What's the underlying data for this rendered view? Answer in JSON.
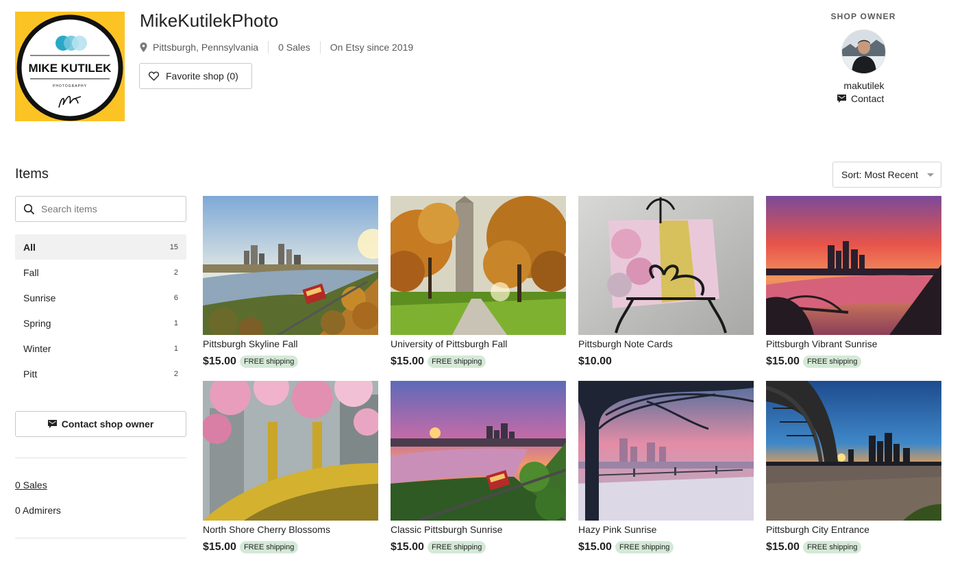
{
  "shop": {
    "name": "MikeKutilekPhoto",
    "logo_text": "MIKE KUTILEK",
    "logo_subtext": "PHOTOGRAPHY",
    "location": "Pittsburgh, Pennsylvania",
    "sales": "0 Sales",
    "since": "On Etsy since 2019",
    "favorite_label": "Favorite shop (0)",
    "icons": {
      "location": "location-pin-icon",
      "favorite": "heart-icon"
    }
  },
  "owner": {
    "label": "SHOP OWNER",
    "username": "makutilek",
    "contact_label": "Contact",
    "icons": {
      "contact": "message-icon"
    }
  },
  "items": {
    "title": "Items",
    "sort_label": "Sort: Most Recent",
    "search_placeholder": "Search items"
  },
  "sidebar": {
    "categories": [
      {
        "label": "All",
        "count": "15",
        "active": true
      },
      {
        "label": "Fall",
        "count": "2"
      },
      {
        "label": "Sunrise",
        "count": "6"
      },
      {
        "label": "Spring",
        "count": "1"
      },
      {
        "label": "Winter",
        "count": "1"
      },
      {
        "label": "Pitt",
        "count": "2"
      }
    ],
    "contact_label": "Contact shop owner",
    "sales_link": "0 Sales",
    "admirers": "0 Admirers"
  },
  "listings": [
    {
      "title": "Pittsburgh Skyline Fall",
      "price": "$15.00",
      "shipping": "FREE shipping"
    },
    {
      "title": "University of Pittsburgh Fall",
      "price": "$15.00",
      "shipping": "FREE shipping"
    },
    {
      "title": "Pittsburgh Note Cards",
      "price": "$10.00",
      "shipping": ""
    },
    {
      "title": "Pittsburgh Vibrant Sunrise",
      "price": "$15.00",
      "shipping": "FREE shipping"
    },
    {
      "title": "North Shore Cherry Blossoms",
      "price": "$15.00",
      "shipping": "FREE shipping"
    },
    {
      "title": "Classic Pittsburgh Sunrise",
      "price": "$15.00",
      "shipping": "FREE shipping"
    },
    {
      "title": "Hazy Pink Sunrise",
      "price": "$15.00",
      "shipping": "FREE shipping"
    },
    {
      "title": "Pittsburgh City Entrance",
      "price": "$15.00",
      "shipping": "FREE shipping"
    }
  ],
  "colors": {
    "logo_background": "#fbc324",
    "active_category": "#f1f1f1",
    "free_shipping_badge": "#d4e9d7",
    "text": "#222222",
    "muted_text": "#595959"
  }
}
